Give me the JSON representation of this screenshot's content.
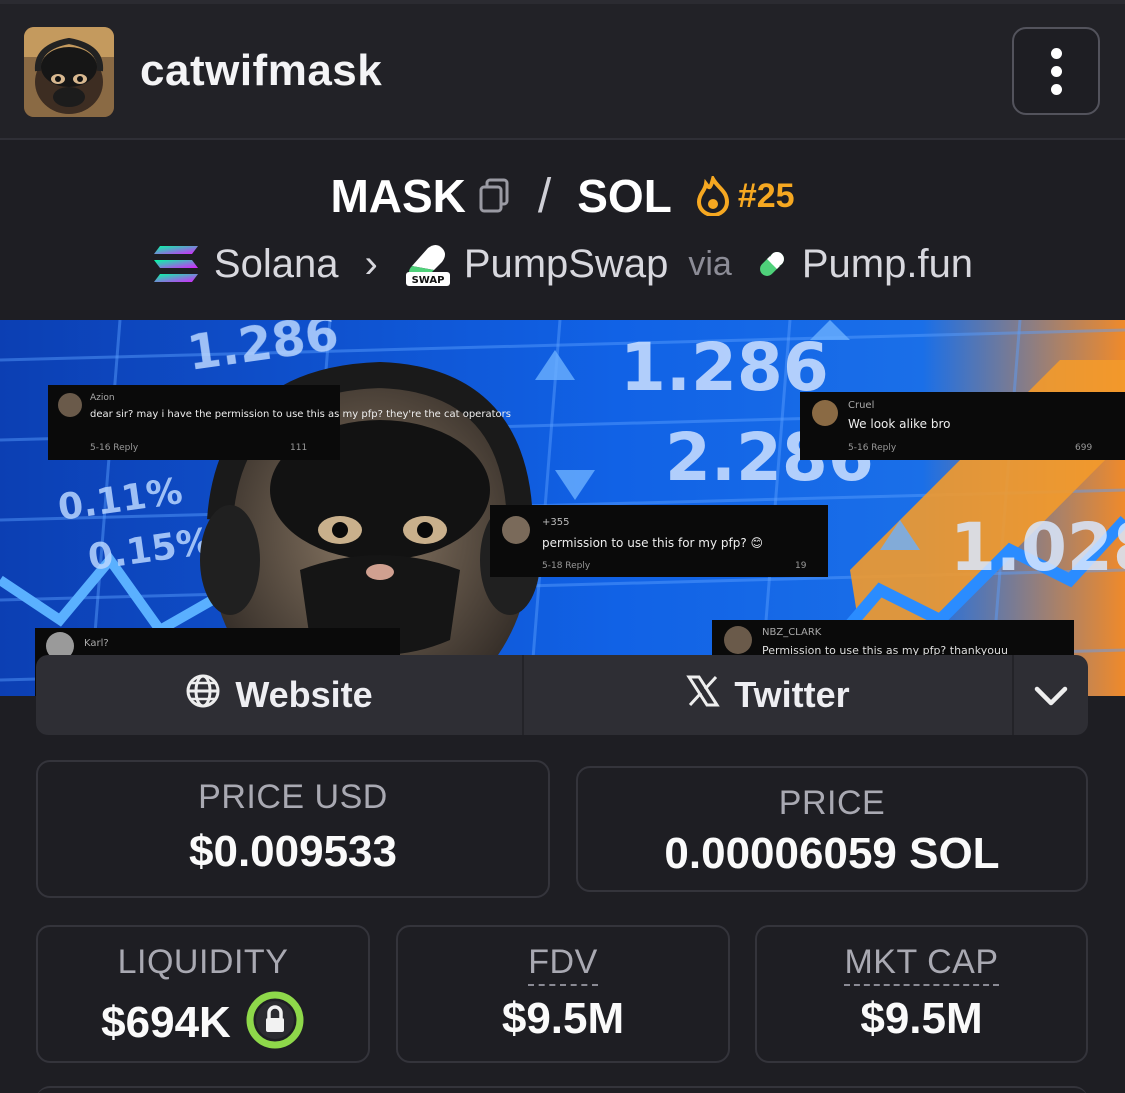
{
  "header": {
    "token_name": "catwifmask",
    "menu_icon": "more-vertical-icon"
  },
  "pair": {
    "base": "MASK",
    "quote": "SOL",
    "separator": "/",
    "rank": "#25",
    "rank_color": "#f6a821"
  },
  "route": {
    "chain": "Solana",
    "dex": "PumpSwap",
    "via": "via",
    "launchpad": "Pump.fun",
    "dex_badge": "SWAP"
  },
  "banner": {
    "ticker_numbers": [
      "1.286",
      "2.286",
      "1.028",
      "0.11%",
      "0.15%",
      "1.286"
    ],
    "comments": [
      {
        "user": "Azion",
        "text": "dear sir? may i have the permission to use this as my pfp? they're the cat operators",
        "meta": "5-16 Reply",
        "likes": "111"
      },
      {
        "user": "Cruel",
        "text": "We look alike bro",
        "meta": "5-16 Reply",
        "likes": "699"
      },
      {
        "user": "+355",
        "text": "permission to use this for my pfp? 😊",
        "meta": "5-18 Reply",
        "likes": "19"
      },
      {
        "user": "Karl?",
        "text": "",
        "meta": "",
        "likes": ""
      },
      {
        "user": "NBZ_CLARK",
        "text": "Permission to use this as my pfp? thankyouu",
        "meta": "",
        "likes": ""
      }
    ]
  },
  "links": {
    "website_label": "Website",
    "twitter_label": "Twitter",
    "website_icon": "globe-icon",
    "twitter_icon": "x-logo-icon",
    "more_icon": "chevron-down-icon"
  },
  "stats": {
    "price_usd_label": "PRICE USD",
    "price_usd_value": "$0.009533",
    "price_label": "PRICE",
    "price_value": "0.00006059 SOL",
    "liquidity_label": "LIQUIDITY",
    "liquidity_value": "$694K",
    "liquidity_icon": "lock-icon",
    "fdv_label": "FDV",
    "fdv_value": "$9.5M",
    "mktcap_label": "MKT CAP",
    "mktcap_value": "$9.5M"
  }
}
